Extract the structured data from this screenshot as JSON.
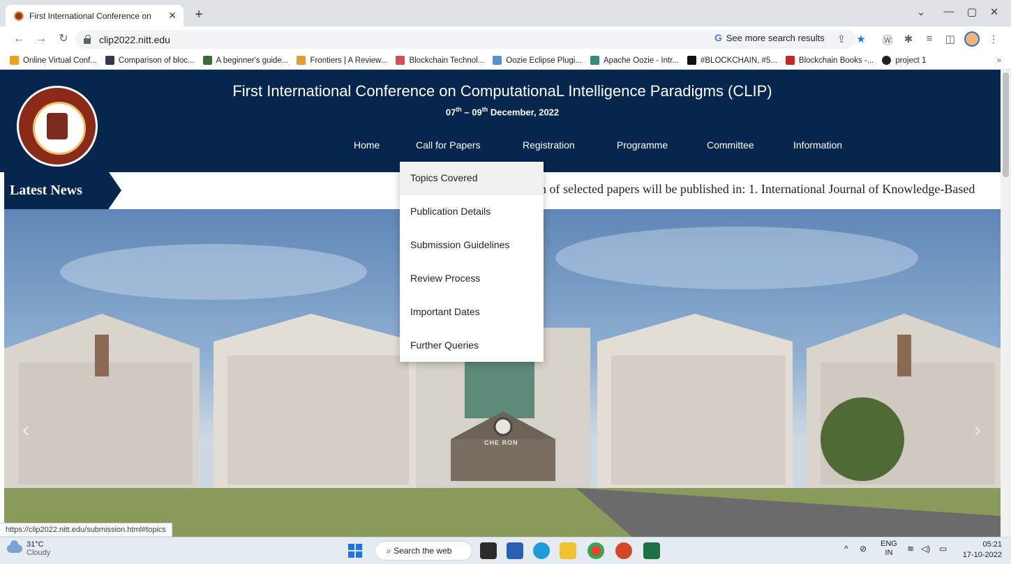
{
  "browser": {
    "tab_title": "First International Conference on",
    "url": "clip2022.nitt.edu",
    "more_search": "See more search results",
    "bookmarks": [
      {
        "label": "Online Virtual Conf...",
        "color": "#f0a020"
      },
      {
        "label": "Comparison of bloc...",
        "color": "#2f3a4a"
      },
      {
        "label": "A beginner's guide...",
        "color": "#3b6a3b"
      },
      {
        "label": "Frontiers | A Review...",
        "color": "#e0a030"
      },
      {
        "label": "Blockchain Technol...",
        "color": "#d94a5a"
      },
      {
        "label": "Oozie Eclipse Plugi...",
        "color": "#5a8fcf"
      },
      {
        "label": "Apache Oozie - Intr...",
        "color": "#3a8a7a"
      },
      {
        "label": "#BLOCKCHAIN, #5...",
        "color": "#111111"
      },
      {
        "label": "Blockchain Books -...",
        "color": "#c02a2a"
      },
      {
        "label": "project 1",
        "color": "#222222"
      }
    ],
    "bookmarks_more": "»",
    "status_url": "https://clip2022.nitt.edu/submission.html#topics"
  },
  "site": {
    "title": "First International Conference on ComputationaL Intelligence Paradigms (CLIP)",
    "dates": {
      "d1": "07",
      "sup1": "th",
      "mid": " – 09",
      "sup2": "th",
      "tail": " December, 2022"
    },
    "nav": [
      "Home",
      "Call for Papers",
      "Registration",
      "Programme",
      "Committee",
      "Information"
    ],
    "news_label": "Latest News",
    "news_text": "ion of selected papers will be published in: 1. International Journal of Knowledge-Based",
    "dropdown": [
      "Topics Covered",
      "Publication Details",
      "Submission Guidelines",
      "Review Process",
      "Important Dates",
      "Further Queries"
    ],
    "hero_sign": "CHE RON"
  },
  "taskbar": {
    "temp": "31°C",
    "weather": "Cloudy",
    "search": "Search the web",
    "lang": "ENG",
    "region": "IN",
    "time": "05:21",
    "date": "17-10-2022"
  }
}
